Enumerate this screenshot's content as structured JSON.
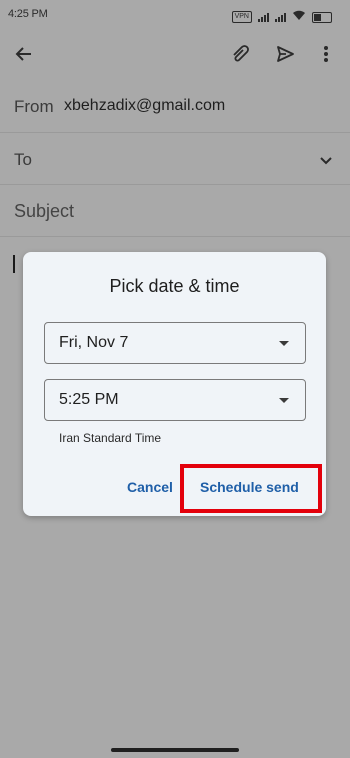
{
  "status_bar": {
    "time": "4:25 PM",
    "vpn": "VPN"
  },
  "compose": {
    "from_label": "From",
    "from_value": "xbehzadix@gmail.com",
    "to_label": "To",
    "subject_placeholder": "Subject"
  },
  "dialog": {
    "title": "Pick date & time",
    "date_value": "Fri, Nov 7",
    "time_value": "5:25 PM",
    "timezone": "Iran Standard Time",
    "cancel_label": "Cancel",
    "schedule_label": "Schedule send"
  },
  "colors": {
    "accent": "#1f5fa8",
    "highlight": "#e3000b",
    "scrim": "#a9a9a9",
    "dialog_bg": "#f0f4f8"
  },
  "icons": {
    "back": "arrow-back-icon",
    "attach": "paperclip-icon",
    "send": "send-icon",
    "more": "more-vert-icon",
    "expand": "chevron-down-icon"
  }
}
